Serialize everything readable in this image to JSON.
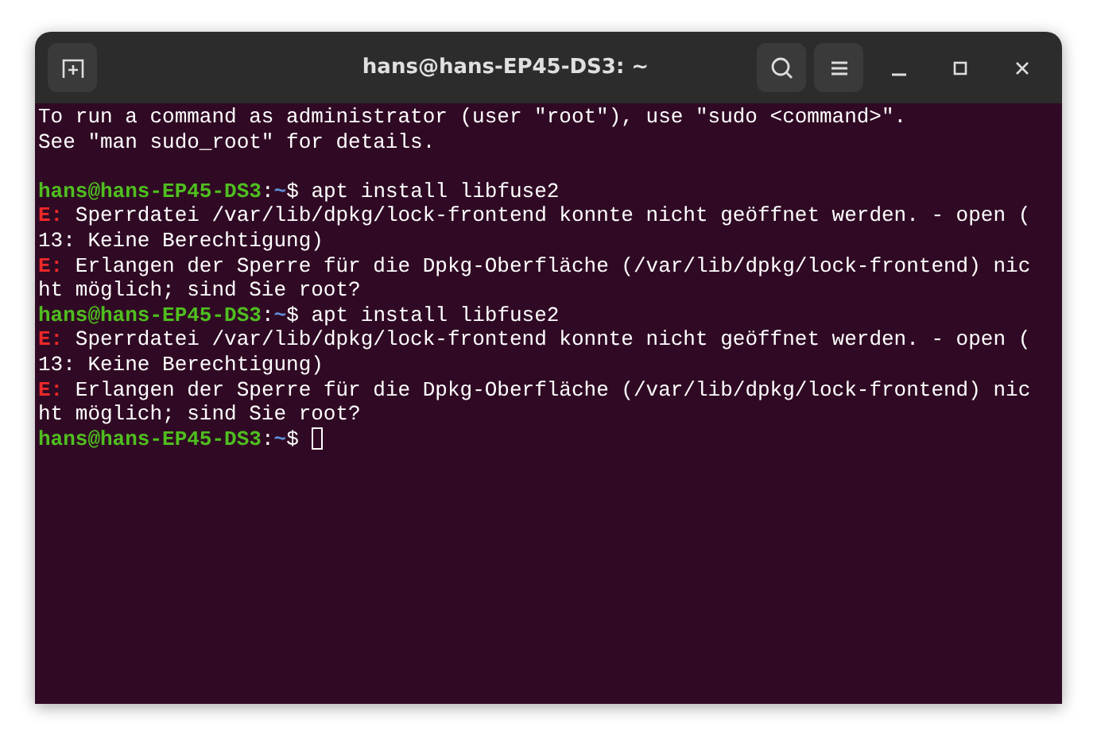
{
  "window": {
    "title": "hans@hans-EP45-DS3: ~"
  },
  "terminal": {
    "lines": [
      {
        "kind": "text",
        "text": "To run a command as administrator (user \"root\"), use \"sudo <command>\"."
      },
      {
        "kind": "text",
        "text": "See \"man sudo_root\" for details."
      },
      {
        "kind": "blank"
      },
      {
        "kind": "prompt",
        "user": "hans@hans-EP45-DS3",
        "separator": ":",
        "path": "~",
        "symbol": "$",
        "command": "apt install libfuse2"
      },
      {
        "kind": "error",
        "prefix": "E:",
        "text": "Sperrdatei /var/lib/dpkg/lock-frontend konnte nicht geöffnet werden. - open ("
      },
      {
        "kind": "text",
        "text": "13: Keine Berechtigung)"
      },
      {
        "kind": "error",
        "prefix": "E:",
        "text": "Erlangen der Sperre für die Dpkg-Oberfläche (/var/lib/dpkg/lock-frontend) nic"
      },
      {
        "kind": "text",
        "text": "ht möglich; sind Sie root?"
      },
      {
        "kind": "prompt",
        "user": "hans@hans-EP45-DS3",
        "separator": ":",
        "path": "~",
        "symbol": "$",
        "command": "apt install libfuse2"
      },
      {
        "kind": "error",
        "prefix": "E:",
        "text": "Sperrdatei /var/lib/dpkg/lock-frontend konnte nicht geöffnet werden. - open ("
      },
      {
        "kind": "text",
        "text": "13: Keine Berechtigung)"
      },
      {
        "kind": "error",
        "prefix": "E:",
        "text": "Erlangen der Sperre für die Dpkg-Oberfläche (/var/lib/dpkg/lock-frontend) nic"
      },
      {
        "kind": "text",
        "text": "ht möglich; sind Sie root?"
      },
      {
        "kind": "prompt",
        "user": "hans@hans-EP45-DS3",
        "separator": ":",
        "path": "~",
        "symbol": "$",
        "cursor": true
      }
    ]
  }
}
